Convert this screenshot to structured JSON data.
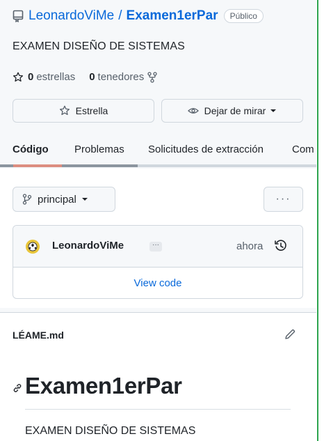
{
  "repo": {
    "owner": "LeonardoViMe",
    "separator": "/",
    "name": "Examen1erPar",
    "visibility": "Público",
    "description": "EXAMEN DISEÑO DE SISTEMAS"
  },
  "stats": {
    "stars_count": "0",
    "stars_label": "estrellas",
    "forks_count": "0",
    "forks_label": "tenedores"
  },
  "actions": {
    "star_label": "Estrella",
    "watch_label": "Dejar de mirar"
  },
  "tabs": [
    {
      "label": "Código",
      "active": true
    },
    {
      "label": "Problemas",
      "active": false
    },
    {
      "label": "Solicitudes de extracción",
      "active": false
    },
    {
      "label": "Com",
      "active": false
    }
  ],
  "branch": {
    "label": "principal",
    "more_label": "···"
  },
  "commit": {
    "author": "LeonardoViMe",
    "ellipsis": "···",
    "time": "ahora",
    "view_code_label": "View code"
  },
  "readme": {
    "file_name": "LÉAME.md",
    "heading": "Examen1erPar",
    "text": "EXAMEN DISEÑO DE SISTEMAS"
  },
  "icons": [
    "repo-icon",
    "star-icon",
    "fork-icon",
    "eye-icon",
    "chevron-down-icon",
    "branch-icon",
    "history-icon",
    "pencil-icon",
    "link-icon",
    "avatar"
  ],
  "colors": {
    "link": "#0969da",
    "text": "#1f2328",
    "muted": "#57606a",
    "border": "#d0d7de",
    "tab_active_underline": "#fd8c73",
    "edge_accent": "#2da44e"
  }
}
